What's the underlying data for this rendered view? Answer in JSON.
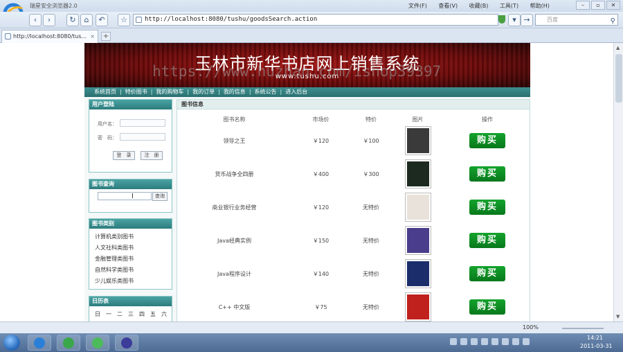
{
  "browser": {
    "app_title": "瑞星安全浏览器2.0",
    "menus": [
      "文件(F)",
      "查看(V)",
      "收藏(B)",
      "工具(T)",
      "帮助(H)"
    ],
    "url": "http://localhost:8080/tushu/goodsSearch.action",
    "search_placeholder": "百度",
    "tab_title": "http://localhost:8080/tus...",
    "zoom": "100%"
  },
  "watermark": "https://www.huzhan.com/ishop39397",
  "site": {
    "banner_title": "玉林市新华书店网上销售系统",
    "banner_url": "www.tushu.com",
    "nav": [
      "系统首页",
      "特价图书",
      "我的购物车",
      "我的订单",
      "我的信息",
      "系统公告",
      "进入后台"
    ]
  },
  "login": {
    "title": "用户登陆",
    "username_label": "用户名：",
    "password_label": "密　码：",
    "login_btn": "登　录",
    "register_btn": "注　册"
  },
  "book_search": {
    "title": "图书查询",
    "button": "查询"
  },
  "categories": {
    "title": "图书类别",
    "items": [
      "计算机类别图书",
      "人文社科类图书",
      "金融管理类图书",
      "自然科学类图书",
      "少儿娱乐类图书"
    ]
  },
  "calendar": {
    "title": "日历表",
    "days": [
      "日",
      "一",
      "二",
      "三",
      "四",
      "五",
      "六"
    ]
  },
  "books": {
    "section_title": "图书信息",
    "headers": [
      "图书名称",
      "市场价",
      "特价",
      "图片",
      "操作"
    ],
    "buy_label": "购买",
    "rows": [
      {
        "name": "领导之王",
        "market": "￥120",
        "special": "￥100",
        "cover": "#3a3a3a"
      },
      {
        "name": "货币战争全四册",
        "market": "￥400",
        "special": "￥300",
        "cover": "#1c2a1f"
      },
      {
        "name": "商业银行业务经营",
        "market": "￥120",
        "special": "无特价",
        "cover": "#e9e2da"
      },
      {
        "name": "Java经典实例",
        "market": "￥150",
        "special": "无特价",
        "cover": "#4a3d8c"
      },
      {
        "name": "Java程序设计",
        "market": "￥140",
        "special": "无特价",
        "cover": "#1b2e6b"
      },
      {
        "name": "C++ 中文版",
        "market": "￥75",
        "special": "无特价",
        "cover": "#c0211d"
      }
    ]
  },
  "clock": {
    "time": "14:21",
    "date": "2011-03-31"
  }
}
